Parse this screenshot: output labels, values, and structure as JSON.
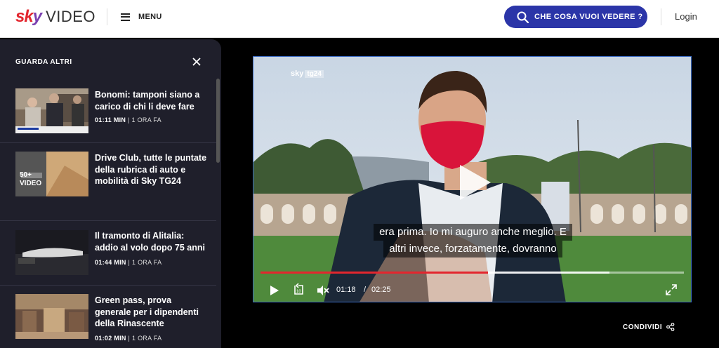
{
  "header": {
    "logo_sky": "sky",
    "logo_video": "VIDEO",
    "menu_label": "MENU",
    "search_label": "CHE COSA VUOI VEDERE ?",
    "login_label": "Login",
    "accent": "#2b35a8"
  },
  "sidebar": {
    "title": "GUARDA ALTRI",
    "items": [
      {
        "title": "Bonomi: tamponi siano a carico di chi li deve fare",
        "duration": "01:11 MIN",
        "ago": "1 ORA FA"
      },
      {
        "title": "Drive Club, tutte le puntate della rubrica di auto e mobilità di Sky TG24",
        "badge_count": "50+",
        "badge_label": "VIDEO"
      },
      {
        "title": "Il tramonto di Alitalia: addio al volo dopo 75 anni",
        "duration": "01:44 MIN",
        "ago": "1 ORA FA"
      },
      {
        "title": "Green pass, prova generale per i dipendenti della Rinascente",
        "duration": "01:02 MIN",
        "ago": "1 ORA FA"
      }
    ]
  },
  "player": {
    "channel": "sky",
    "channel_tag": "tg24",
    "subtitle_line1": "era prima. Io mi auguro anche meglio. E",
    "subtitle_line2": "altri invece, forzatamente, dovranno",
    "current_time": "01:18",
    "separator": "/",
    "duration": "02:25",
    "progress_fraction": 0.538,
    "buffered_fraction": 0.825,
    "progress_color": "#e3262e"
  },
  "share": {
    "label": "CONDIVIDI"
  }
}
